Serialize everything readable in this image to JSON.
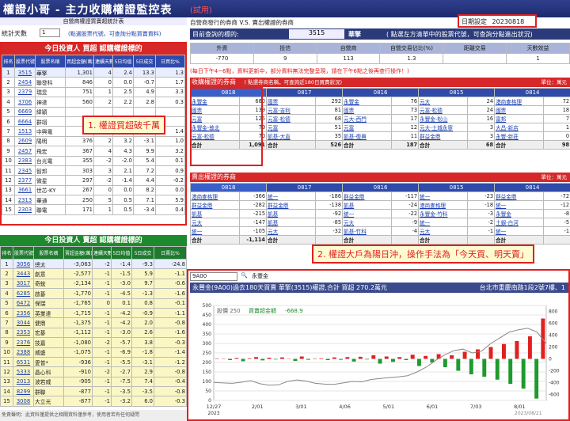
{
  "header": {
    "title": "權證小哥 - 主力收購權證監控表",
    "badge": "(試用)"
  },
  "left": {
    "subtitle": "自營商權證買賣超統計表",
    "ctrl": {
      "label": "統計天數",
      "days": "1",
      "hint": "(點選股票代號，可查詢分點買賣資料)"
    },
    "buy": {
      "title": "今日投資人 買超 認購權證標的",
      "cols": [
        "排名",
        "股票代號",
        "股票名稱",
        "買超金額(萬)",
        "連續天數",
        "5日均值",
        "5日成交",
        "日買比%"
      ],
      "rows": [
        [
          "1",
          "3515",
          "華擎",
          "1,301",
          "4",
          "2.4",
          "13.3",
          "1.3"
        ],
        [
          "2",
          "2454",
          "聯發科",
          "846",
          "0",
          "0.0",
          "-0.7",
          "1.7"
        ],
        [
          "3",
          "2379",
          "瑞昱",
          "751",
          "1",
          "2.5",
          "4.9",
          "3.3"
        ],
        [
          "4",
          "3706",
          "神達",
          "560",
          "2",
          "2.2",
          "2.8",
          "0.3"
        ],
        [
          "5",
          "6669",
          "緯穎",
          "",
          "",
          "",
          "",
          ""
        ],
        [
          "6",
          "6664",
          "群翊",
          "",
          "",
          "",
          "",
          ""
        ],
        [
          "7",
          "1513",
          "中興電",
          "405",
          "1",
          "2.7",
          "-1.3",
          "1.4"
        ],
        [
          "8",
          "2609",
          "陽明",
          "376",
          "2",
          "3.2",
          "-3.1",
          "1.0"
        ],
        [
          "9",
          "2457",
          "飛宏",
          "367",
          "4",
          "4.3",
          "9.9",
          "3.2"
        ],
        [
          "10",
          "2383",
          "台光電",
          "355",
          "-2",
          "-2.0",
          "5.4",
          "0.1"
        ],
        [
          "11",
          "2345",
          "智邦",
          "303",
          "3",
          "2.1",
          "7.2",
          "0.9"
        ],
        [
          "12",
          "2377",
          "微星",
          "297",
          "-2",
          "-1.4",
          "4.4",
          "-0.2"
        ],
        [
          "13",
          "3661",
          "世芯-KY",
          "267",
          "0",
          "0.0",
          "8.2",
          "0.0"
        ],
        [
          "14",
          "2313",
          "華通",
          "250",
          "5",
          "0.5",
          "7.1",
          "5.9"
        ],
        [
          "15",
          "2303",
          "聯電",
          "171",
          "1",
          "0.5",
          "-3.4",
          "0.4"
        ]
      ]
    },
    "sell": {
      "title": "今日投資人 賣超 認購權證標的",
      "cols": [
        "排名",
        "股票代號",
        "股票名稱",
        "賣超金額(萬)",
        "連續天數",
        "5日均值",
        "5日成交",
        "日賣比%"
      ],
      "rows": [
        [
          "1",
          "3056",
          "總太",
          "-3,063",
          "-2",
          "-1.4",
          "-9.3",
          "-24.8"
        ],
        [
          "2",
          "3443",
          "創意",
          "-2,577",
          "-1",
          "-1.5",
          "5.9",
          "-1.1"
        ],
        [
          "3",
          "3017",
          "奇鋐",
          "-2,134",
          "-1",
          "-3.0",
          "9.7",
          "-0.6"
        ],
        [
          "4",
          "6285",
          "啟碁",
          "-1,770",
          "-1",
          "-4.5",
          "-1.3",
          "-1.6"
        ],
        [
          "5",
          "6472",
          "保瑞",
          "-1,765",
          "0",
          "0.1",
          "0.8",
          "-0.1"
        ],
        [
          "6",
          "2356",
          "英業達",
          "-1,715",
          "-1",
          "-4.2",
          "-0.9",
          "-1.1"
        ],
        [
          "7",
          "3044",
          "健鼎",
          "-1,375",
          "-1",
          "-4.2",
          "2.0",
          "-0.8"
        ],
        [
          "8",
          "2353",
          "宏碁",
          "-1,112",
          "-1",
          "-3.0",
          "2.6",
          "-1.6"
        ],
        [
          "9",
          "2376",
          "技嘉",
          "-1,080",
          "-2",
          "-5.7",
          "3.8",
          "-0.3"
        ],
        [
          "10",
          "2388",
          "威盛",
          "-1,075",
          "-1",
          "-6.9",
          "-1.8",
          "-1.4"
        ],
        [
          "11",
          "6531",
          "愛普*",
          "-936",
          "-1",
          "-5.5",
          "-3.1",
          "-1.2"
        ],
        [
          "12",
          "5333",
          "晶心科",
          "-910",
          "-2",
          "-2.7",
          "2.9",
          "-0.8"
        ],
        [
          "13",
          "2013",
          "波若威",
          "-905",
          "-1",
          "-7.5",
          "7.4",
          "-0.4"
        ],
        [
          "14",
          "8299",
          "群聯",
          "-877",
          "-1",
          "-3.5",
          "-3.5",
          "-0.8"
        ],
        [
          "15",
          "3008",
          "大立光",
          "-877",
          "-1",
          "-3.2",
          "6.0",
          "-0.3"
        ]
      ]
    },
    "footer": "免責聲明：此資料僅提供之相關資料僅參考，使用者若有任何疑問"
  },
  "right": {
    "title": "自營商發行的券商 V.S. 賣出權證的券商",
    "date_label": "日期設定",
    "date_value": "20230818",
    "stock_label": "目前查詢的標的:",
    "stock_code": "3515",
    "stock_name": "華擎",
    "stock_hint": "( 點選左方清單中的股票代號，可查詢分點進出狀況)",
    "stats_cols": [
      "外資",
      "投信",
      "自營商",
      "自營交易佔比(%)",
      "距離交易",
      "天數效益"
    ],
    "stats_vals": [
      "-770",
      "9",
      "113",
      "1.3",
      "",
      "1"
    ],
    "warn": "(每日下午4~6點，資料更新中，部分資料無法完整呈現，請在下午6點之後再查行操作！)",
    "buy_sec": {
      "title": "收購權證的券商",
      "sub": "( 點選券商名稱，可查詢近180日買賣狀況)",
      "unit": "單位：萬元"
    },
    "sell_sec": {
      "title": "賣出權證的券商",
      "unit": "單位：萬元"
    },
    "dates": [
      "0818",
      "0817",
      "0816",
      "0815",
      "0814"
    ],
    "sum_label": "合計",
    "buy_rows": [
      [
        [
          "永豐金",
          "680"
        ],
        [
          "國票",
          "292"
        ],
        [
          "永豐金",
          "76"
        ],
        [
          "元大",
          "24"
        ],
        [
          "港商麥格理",
          "72"
        ]
      ],
      [
        [
          "國票",
          "139"
        ],
        [
          "元富-吉利",
          "81"
        ],
        [
          "國票",
          "73"
        ],
        [
          "元富-松德",
          "24"
        ],
        [
          "國票",
          "18"
        ]
      ],
      [
        [
          "元富",
          "125"
        ],
        [
          "元富-松德",
          "68"
        ],
        [
          "元大-西門",
          "17"
        ],
        [
          "永豐金-松山",
          "16"
        ],
        [
          "富邦",
          "7"
        ]
      ],
      [
        [
          "永豐金-敦北",
          "79"
        ],
        [
          "元富",
          "51"
        ],
        [
          "元富",
          "12"
        ],
        [
          "元大-土城永寧",
          "3"
        ],
        [
          "大昌-新店",
          "1"
        ]
      ],
      [
        [
          "元富-松德",
          "70"
        ],
        [
          "凱基-大直",
          "35"
        ],
        [
          "凱基-復興",
          "11"
        ],
        [
          "群益金鼎",
          "3"
        ],
        [
          "永豐-新莊",
          "0"
        ]
      ]
    ],
    "buy_sums": [
      "1,091",
      "526",
      "187",
      "68",
      "98"
    ],
    "sell_rows": [
      [
        [
          "港商麥格理",
          "-366"
        ],
        [
          "統一",
          "-186"
        ],
        [
          "群益金鼎",
          "-117"
        ],
        [
          "統一",
          "-23"
        ],
        [
          "群益金鼎",
          "-72"
        ]
      ],
      [
        [
          "群益金鼎",
          "-282"
        ],
        [
          "群益金鼎",
          "-138"
        ],
        [
          "凱基",
          "-24"
        ],
        [
          "港商麥格理",
          "-18"
        ],
        [
          "統一",
          "-12"
        ]
      ],
      [
        [
          "凱基",
          "-215"
        ],
        [
          "凱基",
          "-92"
        ],
        [
          "統一",
          "-22"
        ],
        [
          "永豐金-竹科",
          "-3"
        ],
        [
          "永豐金",
          "-8"
        ]
      ],
      [
        [
          "元大",
          "-147"
        ],
        [
          "凱基",
          "-85"
        ],
        [
          "元大",
          "-9"
        ],
        [
          "統一",
          "-2"
        ],
        [
          "土銀-白河",
          "-5"
        ]
      ],
      [
        [
          "統一",
          "-105"
        ],
        [
          "元大",
          "-32"
        ],
        [
          "凱基-竹科",
          "-4"
        ],
        [
          "元大",
          "-1"
        ],
        [
          "統一",
          "-1"
        ]
      ]
    ],
    "sell_sums": [
      "-1,114",
      "",
      "",
      "",
      ""
    ]
  },
  "annotations": {
    "a1": "1. 權證買超破千萬",
    "a2": "2. 權證大戶為陽日沖，操作手法為「今天買、明天賣」"
  },
  "chart": {
    "input_value": "9A00",
    "input_hint": "永豐金",
    "bar_text": "永豐金(9A00)過去180天買賣 華擎(3515)權證,合計 買超 270.2萬元",
    "bar_addr": "台北市重慶南路1段2號7樓、1",
    "legend_price": "股價 250",
    "legend_vol": "買賣超金額",
    "legend_val": "-668.9",
    "end_date": "2023/08/21",
    "chart_data": {
      "type": "bar",
      "x_labels": [
        "12/27",
        "2/01",
        "3/01",
        "4/06",
        "5/01",
        "6/01",
        "7/03",
        "8/01"
      ],
      "x_first_sub": "2023",
      "y_left_ticks": [
        0,
        50,
        100,
        150,
        200,
        250,
        300,
        350,
        400,
        450,
        500
      ],
      "y_right_ticks": [
        -600,
        -400,
        -200,
        0,
        200,
        400,
        600,
        800
      ],
      "price": [
        95,
        92,
        90,
        96,
        104,
        88,
        80,
        82,
        100,
        108,
        102,
        90,
        86,
        84,
        92,
        100,
        98,
        110,
        116,
        120,
        124,
        130,
        150,
        175,
        210,
        240,
        262,
        270,
        250,
        260,
        300,
        330,
        360,
        372,
        380,
        360,
        300
      ],
      "flows": [
        0,
        5,
        -20,
        15,
        -40,
        10,
        30,
        -25,
        20,
        -10,
        25,
        5,
        -35,
        40,
        -15,
        0,
        10,
        -20,
        25,
        -15,
        30,
        -45,
        35,
        -10,
        60,
        -80,
        40,
        -50,
        30,
        -20,
        70,
        -120,
        50,
        -60,
        80,
        -140,
        60,
        -200,
        120,
        -260,
        160,
        -300,
        200,
        -350,
        250,
        -420,
        300,
        -500,
        380,
        -668.9,
        680
      ]
    }
  }
}
